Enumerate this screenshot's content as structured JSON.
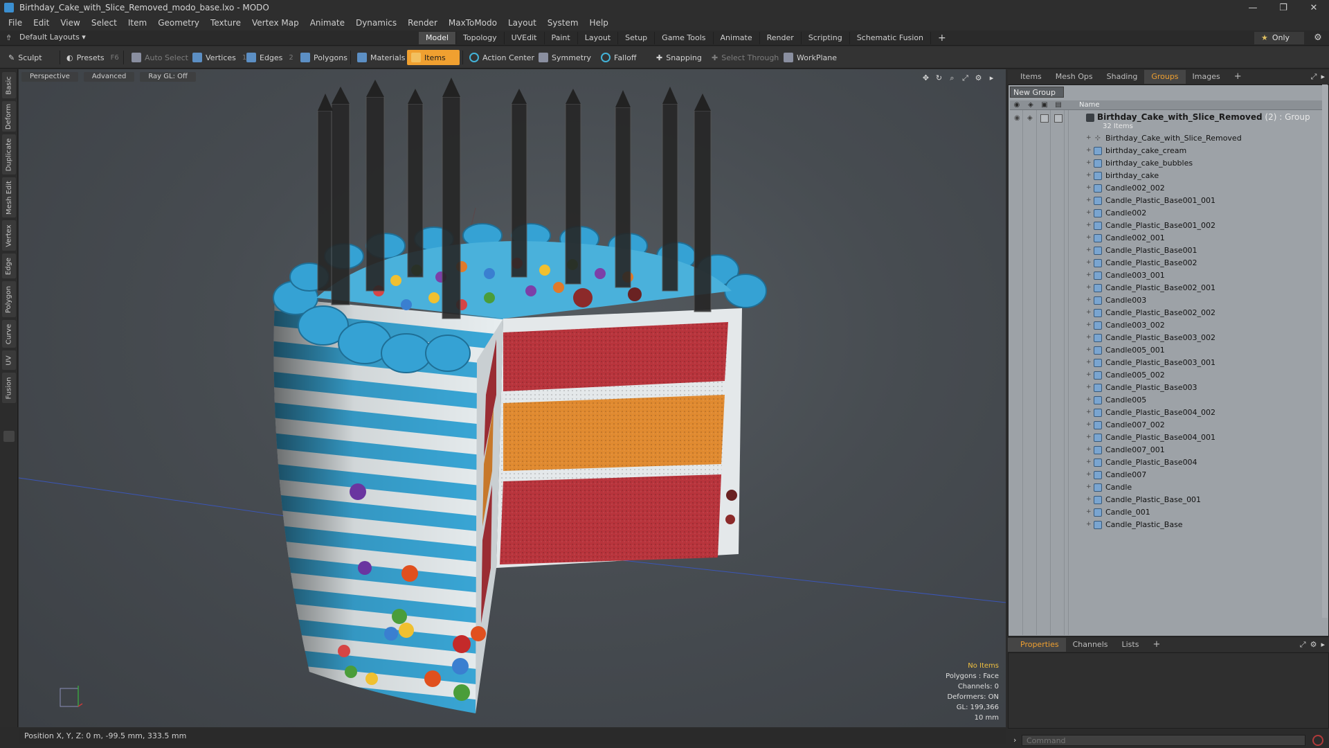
{
  "window": {
    "title": "Birthday_Cake_with_Slice_Removed_modo_base.lxo - MODO",
    "controls": [
      "—",
      "❐",
      "✕"
    ]
  },
  "menu": [
    "File",
    "Edit",
    "View",
    "Select",
    "Item",
    "Geometry",
    "Texture",
    "Vertex Map",
    "Animate",
    "Dynamics",
    "Render",
    "MaxToModo",
    "Layout",
    "System",
    "Help"
  ],
  "modebar": {
    "layouts_label": "Default Layouts ▾",
    "tabs": [
      "Model",
      "Topology",
      "UVEdit",
      "Paint",
      "Layout",
      "Setup",
      "Game Tools",
      "Animate",
      "Render",
      "Scripting",
      "Schematic Fusion"
    ],
    "active_tab": "Model",
    "plus": "+",
    "only_star": "★",
    "only_label": "Only"
  },
  "toolbar": {
    "sculpt": "Sculpt",
    "presets": "Presets",
    "presets_key": "F6",
    "auto_select": "Auto Select",
    "vertices": "Vertices",
    "vertices_key": "1",
    "edges": "Edges",
    "edges_key": "2",
    "polygons": "Polygons",
    "materials": "Materials",
    "items": "Items",
    "action_center": "Action Center",
    "symmetry": "Symmetry",
    "falloff": "Falloff",
    "snapping": "Snapping",
    "select_through": "Select Through",
    "workplane": "WorkPlane"
  },
  "left_tabs": [
    "Basic",
    "Deform",
    "Duplicate",
    "Mesh Edit",
    "Vertex",
    "Edge",
    "Polygon",
    "Curve",
    "UV",
    "Fusion"
  ],
  "viewport": {
    "view": "Perspective",
    "shading": "Advanced",
    "raygl": "Ray GL: Off",
    "info": {
      "selection": "No Items",
      "polygons": "Polygons : Face",
      "channels": "Channels: 0",
      "deformers": "Deformers: ON",
      "gl": "GL: 199,366",
      "scale": "10 mm"
    }
  },
  "status": {
    "position": "Position X, Y, Z:  0 m, -99.5 mm, 333.5 mm"
  },
  "right_panel": {
    "top_tabs": [
      "Items",
      "Mesh Ops",
      "Shading",
      "Groups",
      "Images"
    ],
    "active_top_tab": "Groups",
    "new_group": "New Group",
    "name_header": "Name",
    "root": {
      "name": "Birthday_Cake_with_Slice_Removed",
      "count": " (2) ",
      "type": ": Group",
      "sub": "32 Items"
    },
    "items": [
      "Birthday_Cake_with_Slice_Removed",
      "birthday_cake_cream",
      "birthday_cake_bubbles",
      "birthday_cake",
      "Candle002_002",
      "Candle_Plastic_Base001_001",
      "Candle002",
      "Candle_Plastic_Base001_002",
      "Candle002_001",
      "Candle_Plastic_Base001",
      "Candle_Plastic_Base002",
      "Candle003_001",
      "Candle_Plastic_Base002_001",
      "Candle003",
      "Candle_Plastic_Base002_002",
      "Candle003_002",
      "Candle_Plastic_Base003_002",
      "Candle005_001",
      "Candle_Plastic_Base003_001",
      "Candle005_002",
      "Candle_Plastic_Base003",
      "Candle005",
      "Candle_Plastic_Base004_002",
      "Candle007_002",
      "Candle_Plastic_Base004_001",
      "Candle007_001",
      "Candle_Plastic_Base004",
      "Candle007",
      "Candle",
      "Candle_Plastic_Base_001",
      "Candle_001",
      "Candle_Plastic_Base"
    ],
    "bottom_tabs": [
      "Properties",
      "Channels",
      "Lists"
    ],
    "active_bottom_tab": "Properties",
    "command_placeholder": "Command"
  },
  "colors": {
    "accent": "#f0a030",
    "cake_blue": "#3aa8d8",
    "cake_white": "#e8eef0",
    "sponge_red": "#b8343c",
    "sponge_orange": "#e08a30"
  }
}
